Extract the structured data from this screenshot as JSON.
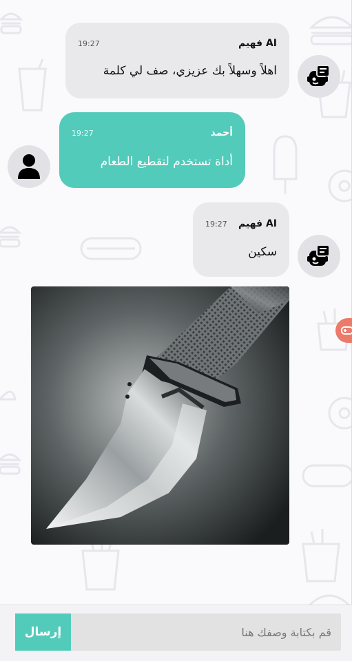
{
  "messages": [
    {
      "sender": "فهيم AI",
      "time": "19:27",
      "text": "اهلاً وسهلاً بك عزيزي، صف لي كلمة"
    },
    {
      "sender": "أحمد",
      "time": "19:27",
      "text": "أداة تستخدم لتقطيع الطعام"
    },
    {
      "sender": "فهيم AI",
      "time": "19:27",
      "text": "سكين"
    }
  ],
  "composer": {
    "placeholder": "قم بكتابة وصفك هنا",
    "send_label": "إرسال"
  },
  "colors": {
    "accent": "#52cbbb",
    "ai_bubble": "#e9e9eb",
    "side_tab": "#ec7a6b"
  },
  "icons": {
    "bot_avatar": "chatbot-icon",
    "user_avatar": "person-icon"
  }
}
